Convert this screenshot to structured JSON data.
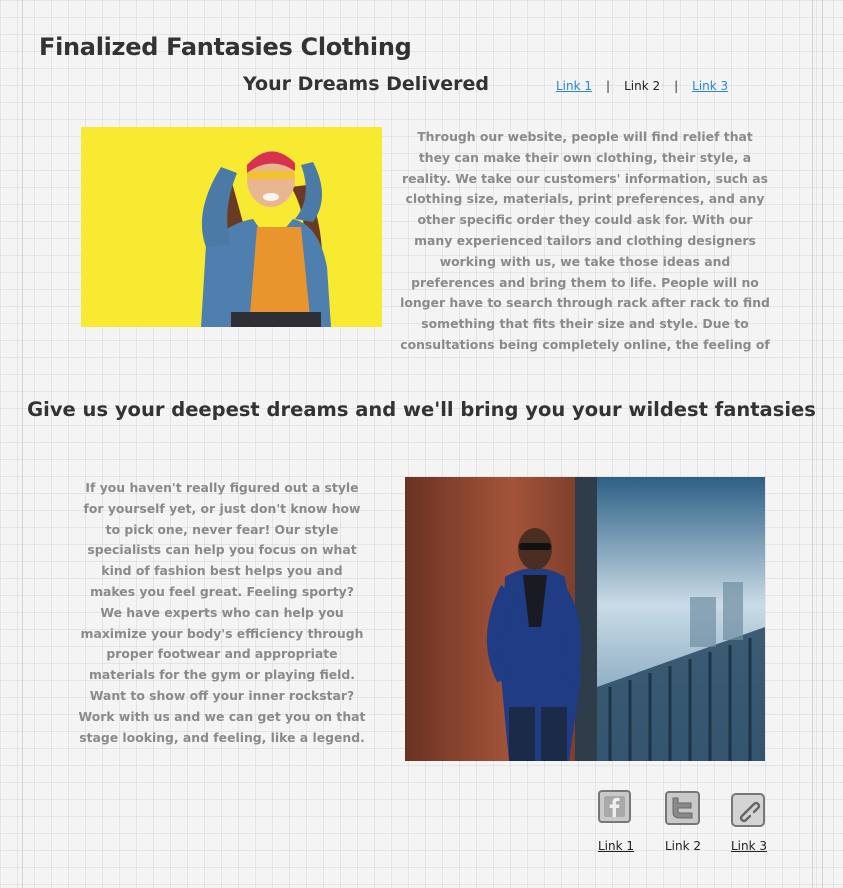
{
  "header": {
    "site_title": "Finalized Fantasies Clothing",
    "tagline": "Your Dreams Delivered"
  },
  "nav": {
    "link1": "Link 1",
    "link2": "Link 2",
    "link3": "Link 3",
    "separator": "|"
  },
  "section1": {
    "image_alt": "Woman in denim jacket with sunglasses against a yellow wall",
    "text": "Through our website, people will find relief that they can make their own clothing, their style, a reality.  We take our customers' information, such as clothing size, materials, print preferences, and any other specific order they could ask for.  With our many experienced tailors and clothing designers working with us, we take those ideas and preferences and bring them to life.  People will no longer have to search through rack after rack to find something that fits their size and style.  Due to consultations being completely online, the feeling of being judged is eliminated, and people can celebrate their fashion their way."
  },
  "mid_heading": "Give us your deepest dreams and we'll bring you your wildest fantasies",
  "section2": {
    "image_alt": "Man in navy suit and sunglasses leaning against a rust-colored wall",
    "text": "If you haven't really figured out a style for yourself yet, or just don't know how to pick one, never fear!  Our style specialists can help you focus on what kind of fashion best helps you and makes you feel great.  Feeling sporty?  We have experts who can help you maximize your body's efficiency through proper footwear and appropriate materials for the gym or playing field.  Want to show off your inner rockstar?  Work with us and we can get you on that stage looking, and feeling, like a legend.  We will work with you to bring out the sense of style that fits right for YOU."
  },
  "footer": {
    "icons": [
      "facebook-icon",
      "twitter-icon",
      "link-icon"
    ],
    "link1": "Link 1",
    "link2": "Link 2",
    "link3": "Link 3"
  },
  "colors": {
    "background": "#f4f4f4",
    "heading": "#333333",
    "body_text": "#8a8a8a",
    "link": "#2a86d0"
  }
}
